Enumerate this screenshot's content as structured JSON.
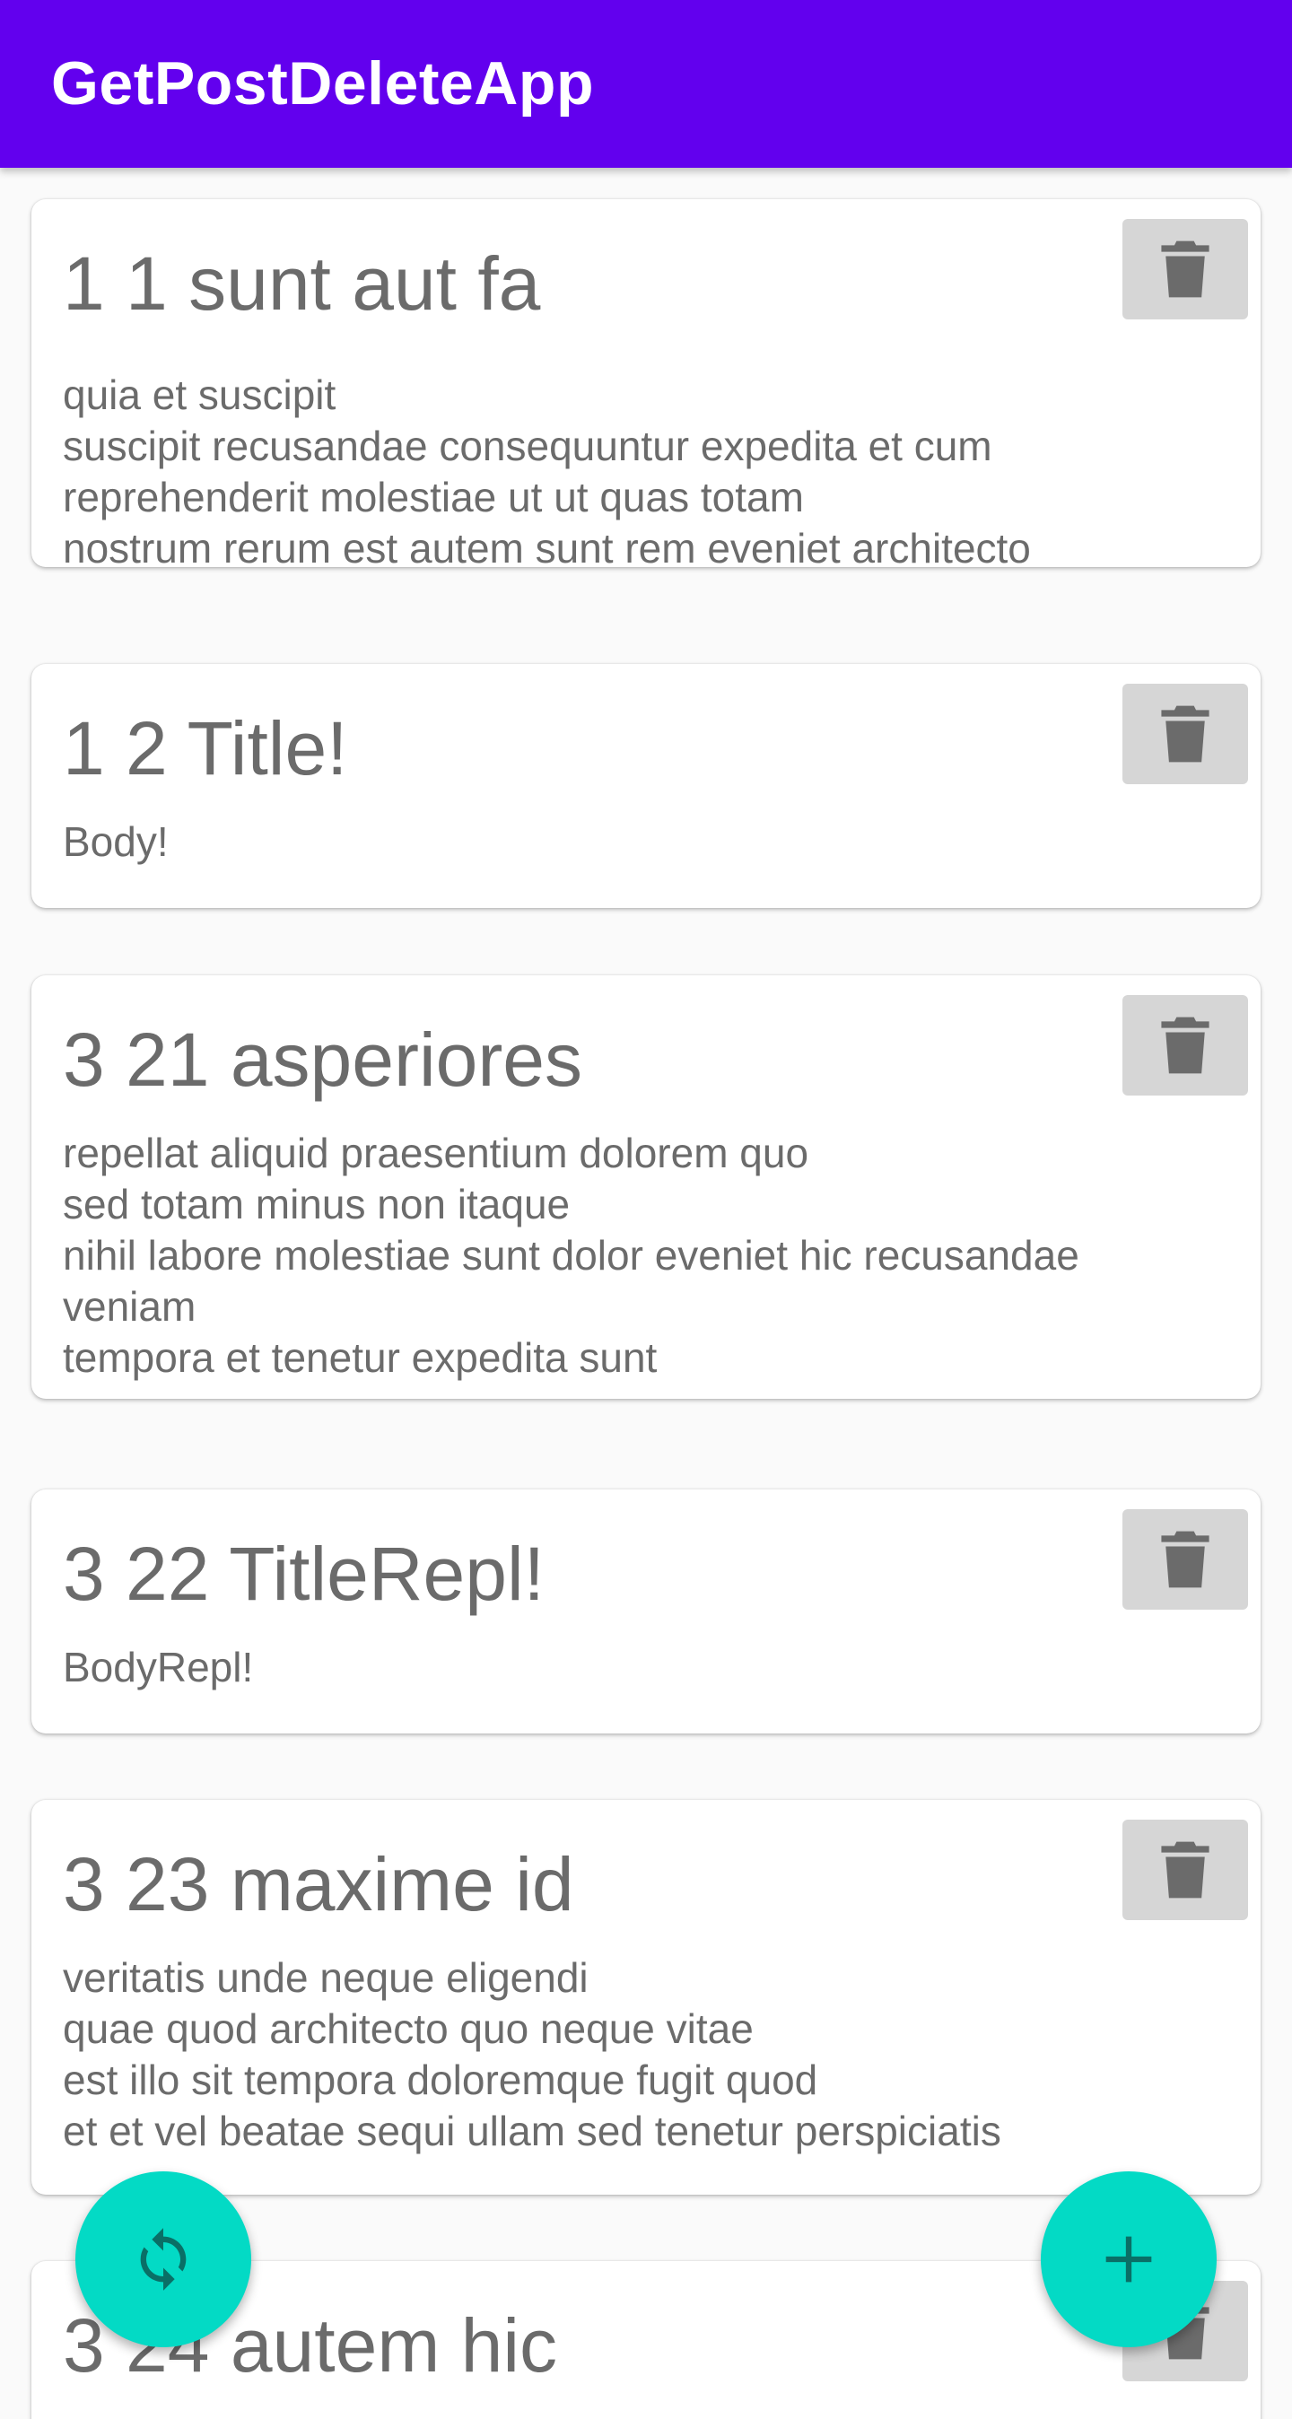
{
  "app": {
    "title": "GetPostDeleteApp"
  },
  "posts": [
    {
      "title": "1 1 sunt aut fa",
      "body": "quia et suscipit\nsuscipit recusandae consequuntur expedita et cum\nreprehenderit molestiae ut ut quas totam\nnostrum rerum est autem sunt rem eveniet architecto"
    },
    {
      "title": "1 2 Title!",
      "body": "Body!"
    },
    {
      "title": "3 21 asperiores",
      "body": "repellat aliquid praesentium dolorem quo\nsed totam minus non itaque\nnihil labore molestiae sunt dolor eveniet hic recusandae\nveniam\ntempora et tenetur expedita sunt"
    },
    {
      "title": "3 22 TitleRepl!",
      "body": "BodyRepl!"
    },
    {
      "title": "3 23 maxime id",
      "body": "veritatis unde neque eligendi\nquae quod architecto quo neque vitae\nest illo sit tempora doloremque fugit quod\net et vel beatae sequi ullam sed tenetur perspiciatis"
    },
    {
      "title": "3 24 autem hic",
      "body": ""
    }
  ],
  "icons": {
    "delete": "trash-icon",
    "refresh": "refresh-icon",
    "add": "plus-icon"
  },
  "colors": {
    "appbar": "#6200ee",
    "fab": "#03dac5",
    "card_text": "#6b6b6b",
    "delete_button_bg": "#d6d6d6"
  }
}
